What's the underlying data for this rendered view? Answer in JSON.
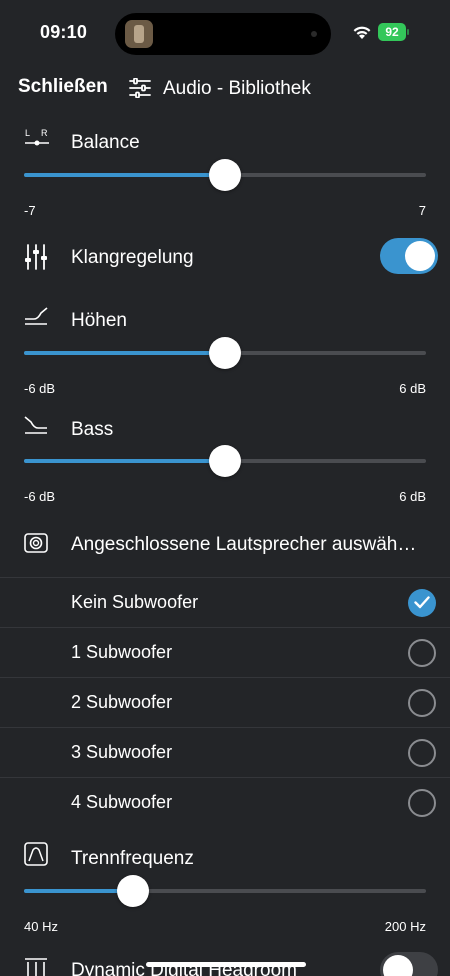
{
  "status": {
    "time": "09:10",
    "battery": "92"
  },
  "header": {
    "close": "Schließen",
    "title": "Audio - Bibliothek"
  },
  "balance": {
    "label": "Balance",
    "icon_left": "L",
    "icon_right": "R",
    "min": "-7",
    "max": "7",
    "value": 0.5
  },
  "equalizer": {
    "label": "Klangregelung",
    "enabled": true
  },
  "treble": {
    "label": "Höhen",
    "min": "-6 dB",
    "max": "6 dB",
    "value": 0.5
  },
  "bass": {
    "label": "Bass",
    "min": "-6 dB",
    "max": "6 dB",
    "value": 0.5
  },
  "speakers": {
    "label": "Angeschlossene Lautsprecher auswäh…",
    "options": [
      {
        "label": "Kein Subwoofer",
        "selected": true
      },
      {
        "label": "1 Subwoofer",
        "selected": false
      },
      {
        "label": "2 Subwoofer",
        "selected": false
      },
      {
        "label": "3 Subwoofer",
        "selected": false
      },
      {
        "label": "4 Subwoofer",
        "selected": false
      }
    ]
  },
  "crossover": {
    "label": "Trennfrequenz",
    "min": "40 Hz",
    "max": "200 Hz",
    "value": 0.27
  },
  "headroom": {
    "label": "Dynamic Digital Headroom",
    "enabled": false
  },
  "colors": {
    "accent": "#3a94cf",
    "background": "#232528",
    "track": "#4a4c50"
  }
}
